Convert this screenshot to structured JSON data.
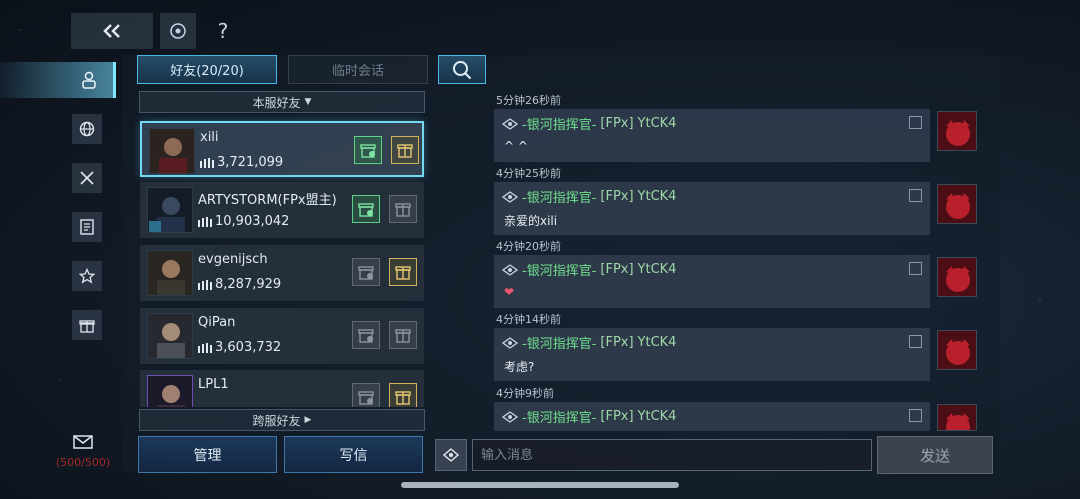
{
  "help": {
    "label": "?"
  },
  "icons": {
    "back": "double-chevron-left-icon",
    "target": "target-icon",
    "friends": "person-icon",
    "globe": "globe-icon",
    "combat": "crossed-swords-icon",
    "log": "document-icon",
    "star": "star-icon",
    "gift": "gift-icon",
    "mail": "mail-icon",
    "search": "search-icon"
  },
  "mail": {
    "count": "(500/500)"
  },
  "tabs": {
    "friends": "好友(20/20)",
    "temp_chat": "临时会话"
  },
  "sections": {
    "local": "本服好友",
    "cross": "跨服好友"
  },
  "friends": [
    {
      "name": "xili",
      "score": "3,721,099"
    },
    {
      "name": "ARTYSTORM(FPx盟主)",
      "score": "10,903,042"
    },
    {
      "name": "evgenijsch",
      "score": "8,287,929"
    },
    {
      "name": "QiPan",
      "score": "3,603,732"
    },
    {
      "name": "LPL1",
      "score": ""
    }
  ],
  "buttons": {
    "manage": "管理",
    "write": "写信",
    "send": "发送"
  },
  "chat": {
    "sender": {
      "title": "-银河指挥官-",
      "tag": "[FPx]",
      "name": "YtCK4"
    },
    "messages": [
      {
        "time": "5分钟26秒前",
        "text": "^ ^"
      },
      {
        "time": "4分钟25秒前",
        "text": "亲爱的xili"
      },
      {
        "time": "4分钟20秒前",
        "text": "❤"
      },
      {
        "time": "4分钟14秒前",
        "text": "考虑?"
      },
      {
        "time": "4分钟9秒前",
        "text": ""
      }
    ]
  },
  "input": {
    "placeholder": "输入消息"
  },
  "colors": {
    "accent": "#49b8e6",
    "sender_title": "#6fe08d",
    "mail_count": "#a22a2a"
  }
}
